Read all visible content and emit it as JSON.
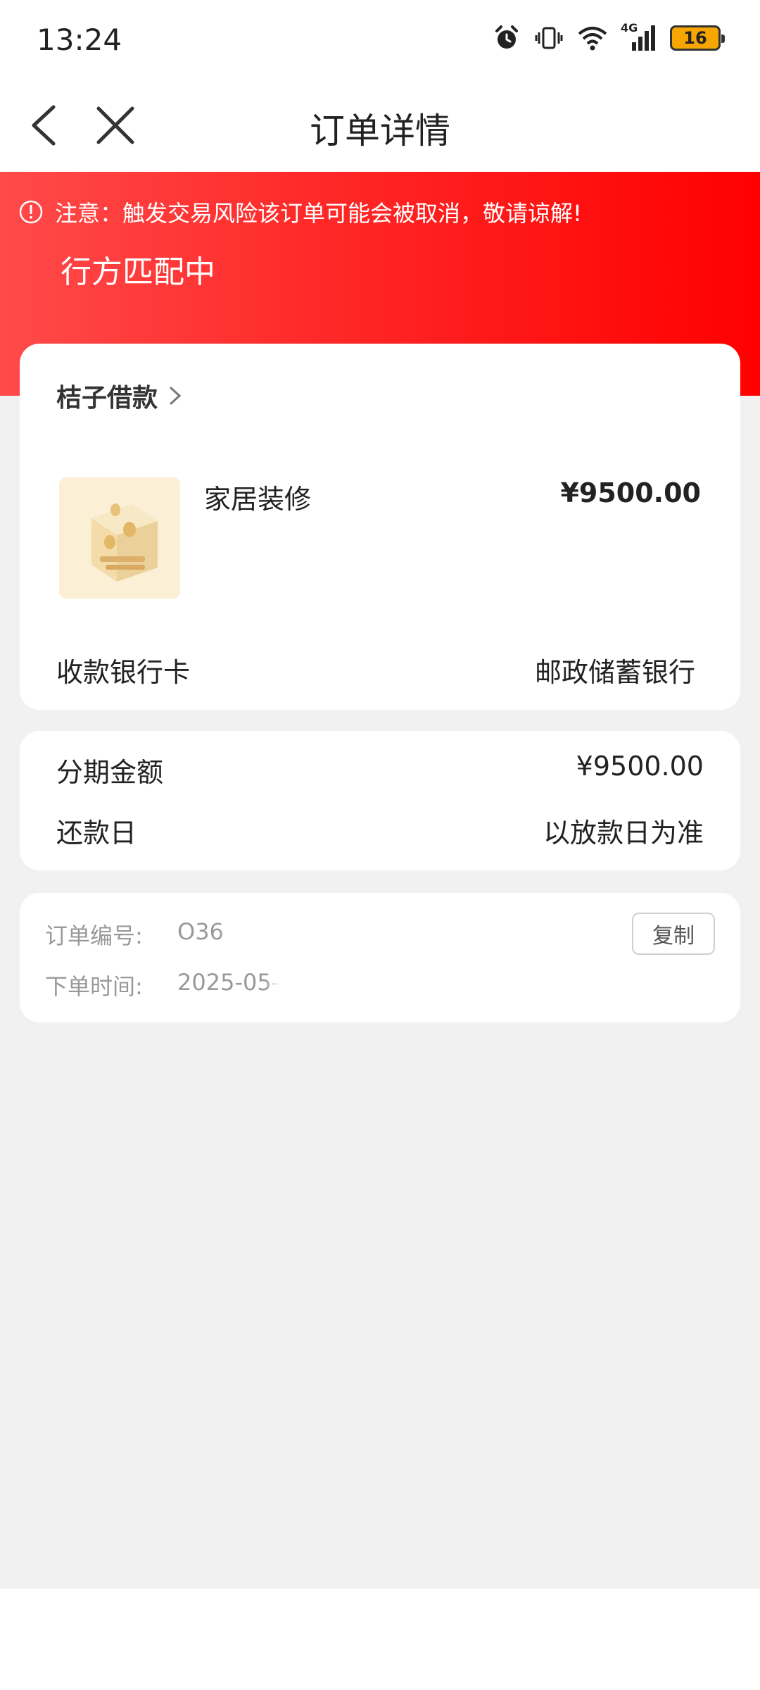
{
  "status_bar": {
    "time": "13:24",
    "network": "4G",
    "battery": "16"
  },
  "nav": {
    "title": "订单详情"
  },
  "header": {
    "warning": "注意：触发交易风险该订单可能会被取消，敬请谅解!",
    "status": "行方匹配中",
    "colors": {
      "gradient_start": "#ff4a4a",
      "gradient_end": "#ff0000"
    }
  },
  "product": {
    "name": "桔子借款",
    "item_name": "家居装修",
    "item_price": "¥9500.00",
    "bank_label": "收款银行卡",
    "bank_value": "邮政储蓄银行"
  },
  "amount": {
    "installment_label": "分期金额",
    "installment_value": "¥9500.00",
    "repay_label": "还款日",
    "repay_value": "以放款日为准"
  },
  "order": {
    "number_label": "订单编号:",
    "number_value": "O36",
    "time_label": "下单时间:",
    "time_value": "2025-05-",
    "copy_label": "复制"
  }
}
